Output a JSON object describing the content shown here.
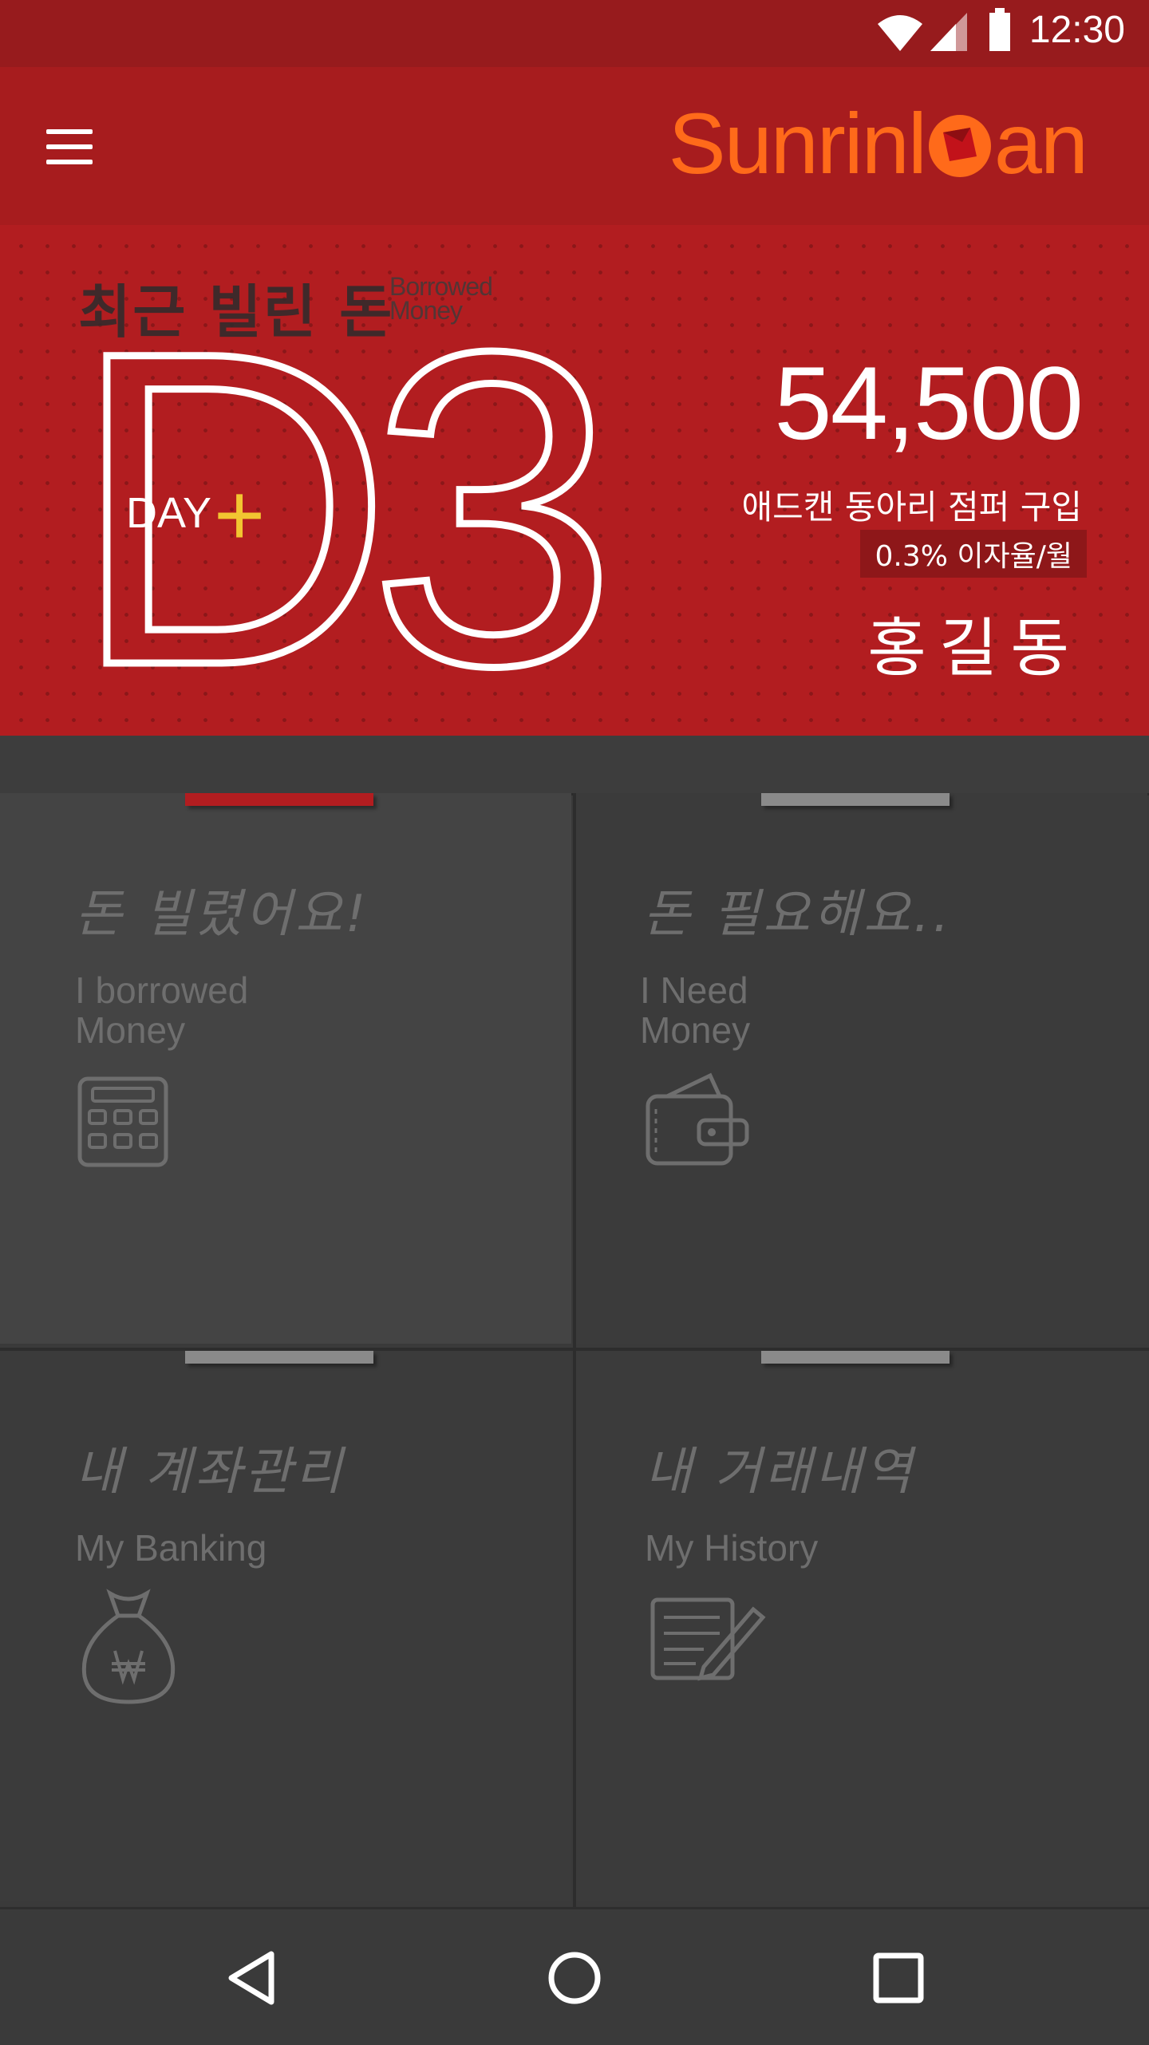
{
  "status_bar": {
    "time": "12:30"
  },
  "app_bar": {
    "brand_left": "Sunrinl",
    "brand_right": "an"
  },
  "hero": {
    "title": "최근 빌린 돈",
    "subtitle_line1": "Borrowed",
    "subtitle_line2": "Money",
    "d_value": "D3",
    "day_label": "DAY",
    "day_sign": "+",
    "amount": "54,500",
    "item": "애드캔 동아리 점퍼 구입",
    "rate": "0.3% 이자율/월",
    "borrower": "홍길동"
  },
  "tiles": [
    {
      "hangul": "돈 빌렸어요!",
      "en1": "I borrowed",
      "en2": "Money",
      "icon": "calculator-icon",
      "active": true
    },
    {
      "hangul": "돈 필요해요..",
      "en1": "I Need",
      "en2": "Money",
      "icon": "wallet-icon",
      "active": false
    },
    {
      "hangul": "내 계좌관리",
      "en1": "My Banking",
      "en2": "",
      "icon": "money-bag-icon",
      "active": false
    },
    {
      "hangul": "내 거래내역",
      "en1": "My History",
      "en2": "",
      "icon": "notepad-icon",
      "active": false
    }
  ],
  "colors": {
    "primary": "#a71c1e",
    "hero": "#b21d20",
    "accent": "#ff6a1a",
    "plus": "#f2c531"
  }
}
